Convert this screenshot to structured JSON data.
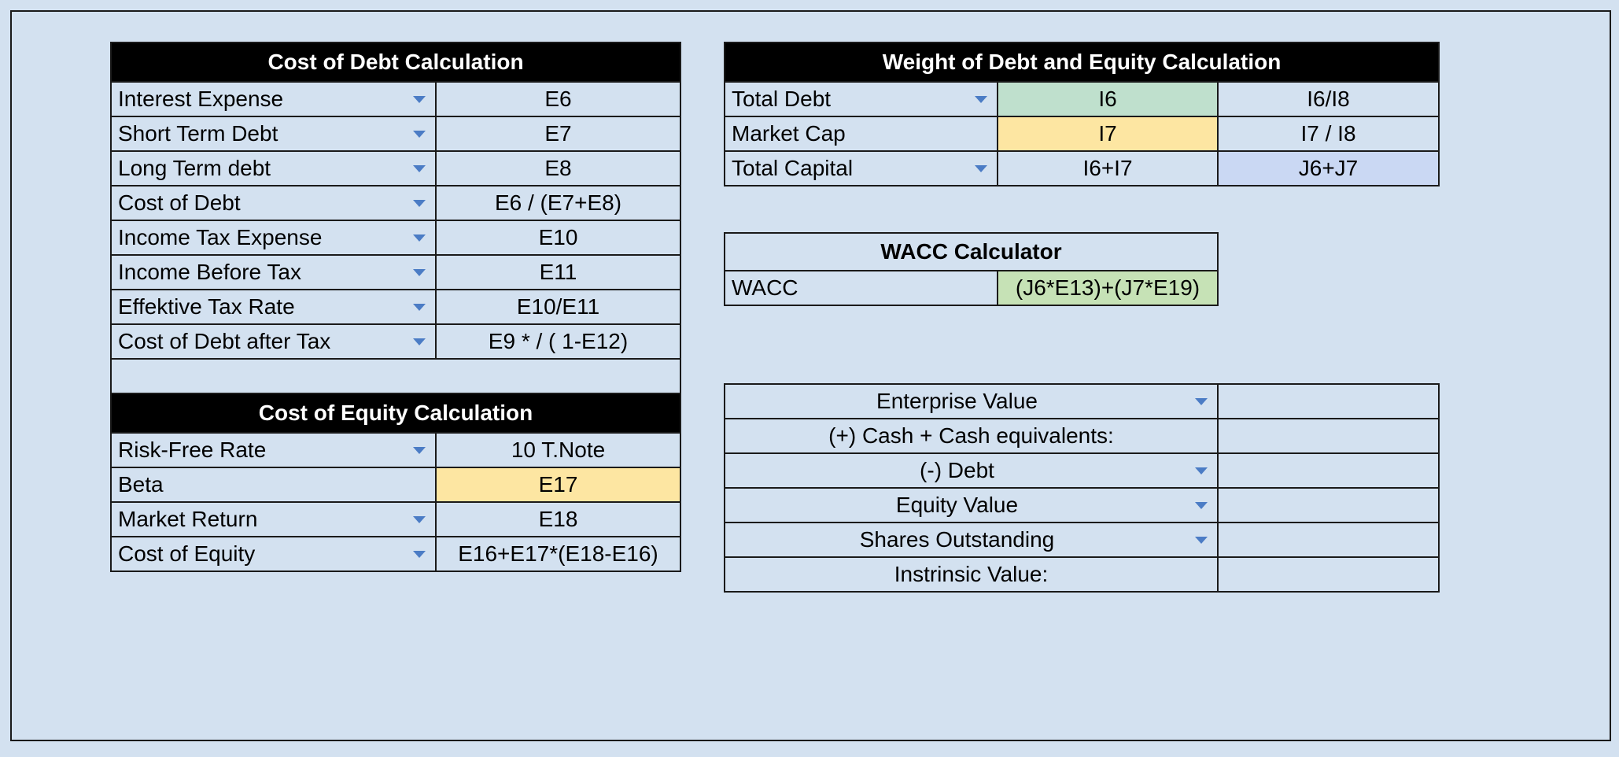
{
  "cost_of_debt": {
    "title": "Cost of Debt Calculation",
    "rows": [
      {
        "label": "Interest Expense",
        "value": "E6"
      },
      {
        "label": "Short Term Debt",
        "value": "E7"
      },
      {
        "label": "Long Term debt",
        "value": "E8"
      },
      {
        "label": "Cost of Debt",
        "value": "E6 / (E7+E8)"
      },
      {
        "label": "Income Tax Expense",
        "value": "E10"
      },
      {
        "label": "Income Before Tax",
        "value": "E11"
      },
      {
        "label": "Effektive Tax Rate",
        "value": "E10/E11"
      },
      {
        "label": "Cost of Debt after Tax",
        "value": "E9 * / ( 1-E12)"
      }
    ]
  },
  "cost_of_equity": {
    "title": "Cost of Equity Calculation",
    "rows": [
      {
        "label": "Risk-Free Rate",
        "value": "10 T.Note"
      },
      {
        "label": "Beta",
        "value": "E17"
      },
      {
        "label": "Market Return",
        "value": "E18"
      },
      {
        "label": "Cost of Equity",
        "value": "E16+E17*(E18-E16)"
      }
    ]
  },
  "weights": {
    "title": "Weight of Debt and Equity Calculation",
    "rows": [
      {
        "label": "Total Debt",
        "value": "I6",
        "weight": "I6/I8"
      },
      {
        "label": "Market Cap",
        "value": "I7",
        "weight": "I7 / I8"
      },
      {
        "label": "Total Capital",
        "value": "I6+I7",
        "weight": "J6+J7"
      }
    ]
  },
  "wacc": {
    "title": "WACC Calculator",
    "label": "WACC",
    "value": "(J6*E13)+(J7*E19)"
  },
  "valuation": {
    "rows": [
      {
        "label": "Enterprise Value",
        "value": ""
      },
      {
        "label": "(+) Cash + Cash equivalents:",
        "value": ""
      },
      {
        "label": "(-) Debt",
        "value": ""
      },
      {
        "label": "Equity Value",
        "value": ""
      },
      {
        "label": "Shares Outstanding",
        "value": ""
      },
      {
        "label": "Instrinsic Value:",
        "value": ""
      }
    ]
  },
  "colors": {
    "background": "#d3e1f0",
    "header": "#000000",
    "highlight_yellow": "#fde6a2",
    "highlight_green": "#bfe0cd",
    "highlight_lavender": "#cad8f3",
    "dropdown_arrow": "#4b7cc5"
  }
}
